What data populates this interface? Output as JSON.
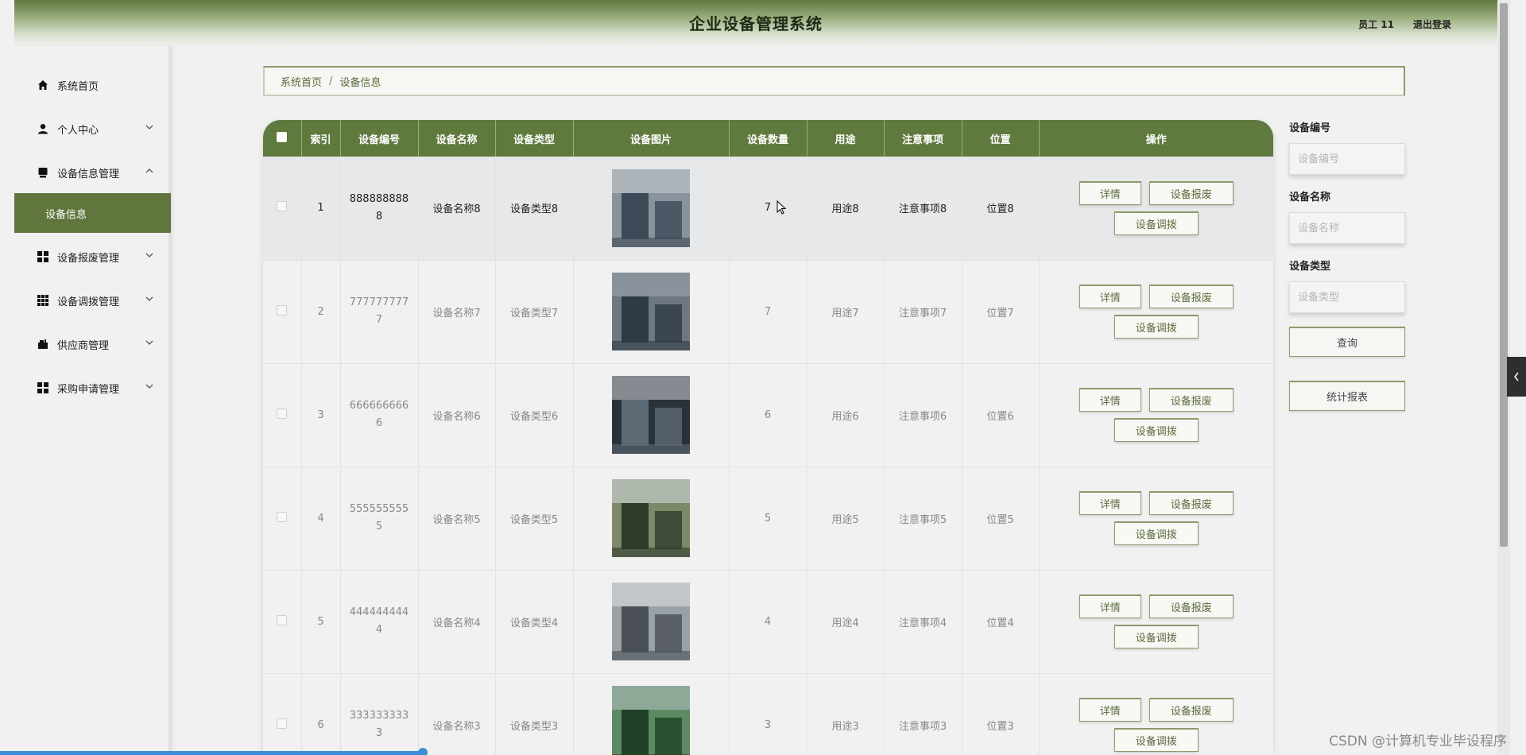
{
  "header": {
    "title": "企业设备管理系统",
    "user": "员工 11",
    "logout": "退出登录"
  },
  "sidebar": {
    "items": [
      {
        "label": "系统首页",
        "icon": "home-icon",
        "expand": ""
      },
      {
        "label": "个人中心",
        "icon": "user-icon",
        "expand": "⌄"
      },
      {
        "label": "设备信息管理",
        "icon": "device-icon",
        "expand": "⌃"
      },
      {
        "label": "设备信息",
        "icon": "",
        "expand": ""
      },
      {
        "label": "设备报废管理",
        "icon": "grid-icon",
        "expand": "⌄"
      },
      {
        "label": "设备调拨管理",
        "icon": "grid9-icon",
        "expand": "⌄"
      },
      {
        "label": "供应商管理",
        "icon": "supplier-icon",
        "expand": "⌄"
      },
      {
        "label": "采购申请管理",
        "icon": "grid-icon",
        "expand": "⌄"
      }
    ]
  },
  "breadcrumb": {
    "home": "系统首页",
    "separator": "/",
    "current": "设备信息"
  },
  "table": {
    "columns": [
      "",
      "索引",
      "设备编号",
      "设备名称",
      "设备类型",
      "设备图片",
      "设备数量",
      "用途",
      "注意事项",
      "位置",
      "操作"
    ],
    "rows": [
      {
        "index": "1",
        "code": "8888888888",
        "name": "设备名称8",
        "type": "设备类型8",
        "qty": "7",
        "use": "用途8",
        "notes": "注意事项8",
        "location": "位置8"
      },
      {
        "index": "2",
        "code": "7777777777",
        "name": "设备名称7",
        "type": "设备类型7",
        "qty": "7",
        "use": "用途7",
        "notes": "注意事项7",
        "location": "位置7"
      },
      {
        "index": "3",
        "code": "6666666666",
        "name": "设备名称6",
        "type": "设备类型6",
        "qty": "6",
        "use": "用途6",
        "notes": "注意事项6",
        "location": "位置6"
      },
      {
        "index": "4",
        "code": "5555555555",
        "name": "设备名称5",
        "type": "设备类型5",
        "qty": "5",
        "use": "用途5",
        "notes": "注意事项5",
        "location": "位置5"
      },
      {
        "index": "5",
        "code": "4444444444",
        "name": "设备名称4",
        "type": "设备类型4",
        "qty": "4",
        "use": "用途4",
        "notes": "注意事项4",
        "location": "位置4"
      },
      {
        "index": "6",
        "code": "3333333333",
        "name": "设备名称3",
        "type": "设备类型3",
        "qty": "3",
        "use": "用途3",
        "notes": "注意事项3",
        "location": "位置3"
      }
    ],
    "actions": {
      "detail": "详情",
      "scrap": "设备报废",
      "transfer": "设备调拨"
    }
  },
  "search": {
    "code_label": "设备编号",
    "code_placeholder": "设备编号",
    "name_label": "设备名称",
    "name_placeholder": "设备名称",
    "type_label": "设备类型",
    "type_placeholder": "设备类型",
    "query_button": "查询",
    "report_button": "统计报表"
  },
  "watermark": "CSDN @计算机专业毕设程序",
  "colors": {
    "accent": "#5f7a3d",
    "accent_light": "#9aad7d",
    "background": "#f1f1f1",
    "progress_bar": "#3a8fd8"
  }
}
